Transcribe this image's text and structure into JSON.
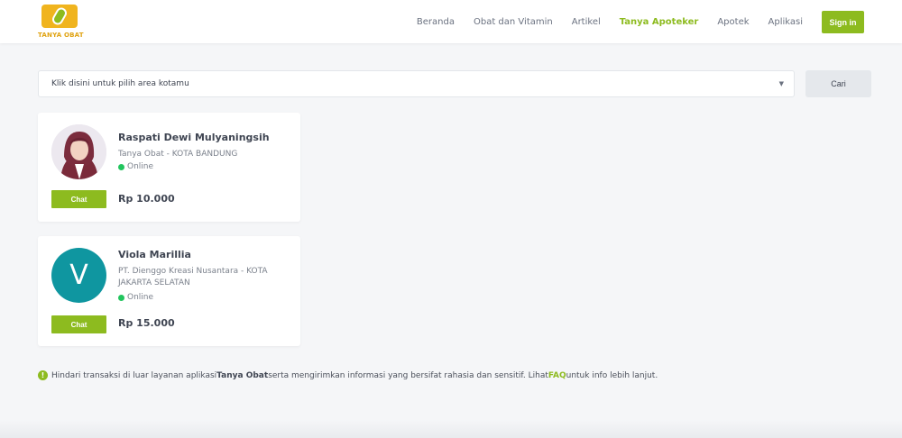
{
  "brand": {
    "name": "TANYA OBAT"
  },
  "nav": {
    "items": [
      "Beranda",
      "Obat dan Vitamin",
      "Artikel",
      "Tanya Apoteker",
      "Apotek",
      "Aplikasi"
    ],
    "active": "Tanya Apoteker",
    "signin_label": "Sign in"
  },
  "search": {
    "area_placeholder": "Klik disini untuk pilih area kotamu",
    "button_label": "Cari"
  },
  "pharmacists": [
    {
      "name": "Raspati Dewi Mulyaningsih",
      "org": "Tanya Obat - KOTA BANDUNG",
      "status": "Online",
      "price": "Rp 10.000",
      "chat_label": "Chat"
    },
    {
      "name": "Viola Marillia",
      "avatar_letter": "V",
      "org": "PT. Dienggo Kreasi Nusantara - KOTA JAKARTA SELATAN",
      "status": "Online",
      "price": "Rp 15.000",
      "chat_label": "Chat"
    }
  ],
  "notice": {
    "part1": "Hindari transaksi di luar layanan aplikasi ",
    "brand": "Tanya Obat",
    "part2": " serta mengirimkan informasi yang bersifat rahasia dan sensitif. Lihat ",
    "faq": "FAQ",
    "part3": " untuk info lebih lanjut."
  },
  "colors": {
    "accent": "#8dbb1f",
    "online": "#22c55e",
    "avatar_bg": "#0f96a0",
    "logo": "#f0b41e"
  }
}
